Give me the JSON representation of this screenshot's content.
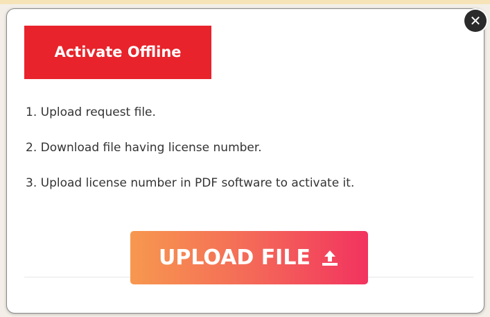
{
  "dialog": {
    "title": "Activate Offline",
    "close_icon": "close-icon",
    "steps": [
      "1. Upload request file.",
      "2. Download file having license number.",
      "3. Upload license number in PDF software to activate it."
    ],
    "upload_button": {
      "label": "UPLOAD FILE",
      "icon": "upload-icon"
    }
  },
  "colors": {
    "title_bg": "#e8232b",
    "button_gradient_start": "#f7984f",
    "button_gradient_end": "#f2335f",
    "close_bg": "#2b2b2b"
  }
}
